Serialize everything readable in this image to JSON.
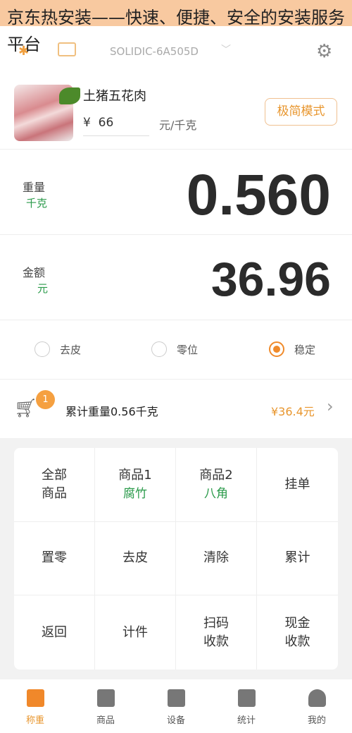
{
  "watermark": "京东热安装——快速、便捷、安全的安装服务平台",
  "header": {
    "device": "SOLIDIC-6A505D"
  },
  "product": {
    "name": "土猪五花肉",
    "currency": "¥",
    "price": "66",
    "unit": "元/千克",
    "mode_button": "极简模式"
  },
  "weight": {
    "label": "重量",
    "unit": "千克",
    "value": "0.560"
  },
  "amount": {
    "label": "金额",
    "unit": "元",
    "value": "36.96"
  },
  "options": [
    {
      "label": "去皮",
      "checked": false
    },
    {
      "label": "零位",
      "checked": false
    },
    {
      "label": "稳定",
      "checked": true
    }
  ],
  "cart": {
    "badge": "1",
    "summary": "累计重量0.56千克",
    "total": "¥36.4元"
  },
  "keys": [
    {
      "label": "全部\n商品"
    },
    {
      "label": "商品1",
      "sub": "腐竹"
    },
    {
      "label": "商品2",
      "sub": "八角"
    },
    {
      "label": "挂单"
    },
    {
      "label": "置零"
    },
    {
      "label": "去皮"
    },
    {
      "label": "清除"
    },
    {
      "label": "累计"
    },
    {
      "label": "返回"
    },
    {
      "label": "计件"
    },
    {
      "label": "扫码\n收款"
    },
    {
      "label": "现金\n收款"
    }
  ],
  "tabs": [
    {
      "label": "称重",
      "icon": "scale-icon"
    },
    {
      "label": "商品",
      "icon": "bag-icon"
    },
    {
      "label": "设备",
      "icon": "device-icon"
    },
    {
      "label": "统计",
      "icon": "chart-icon"
    },
    {
      "label": "我的",
      "icon": "user-icon"
    }
  ],
  "colors": {
    "accent": "#f08a2a",
    "green": "#2a9a4a"
  }
}
